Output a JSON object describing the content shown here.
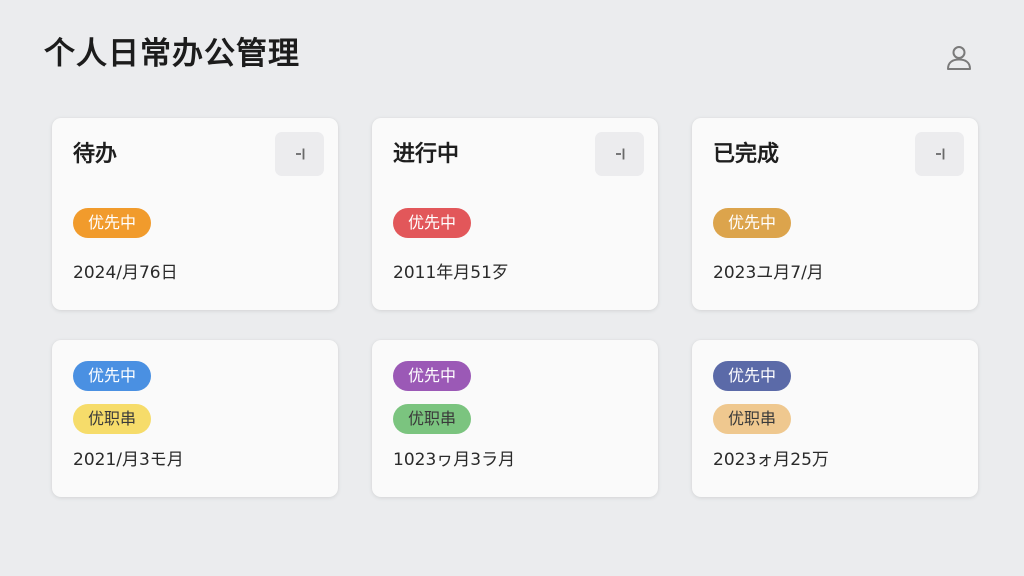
{
  "header": {
    "title": "个人日常办公管理",
    "user_icon": "user-icon"
  },
  "colors": {
    "orange": "#f19b2c",
    "red": "#e2575a",
    "amber": "#dca44c",
    "blue": "#4a90e2",
    "purple": "#9b59b6",
    "indigo": "#5b6aa8",
    "yellow": "#f6dc6a",
    "green": "#7bc47f",
    "peach": "#efc88f"
  },
  "columns": [
    {
      "title": "待办",
      "add_icon": "add-icon",
      "badge": "优先中",
      "date": "2024/月76日"
    },
    {
      "title": "进行中",
      "add_icon": "add-icon",
      "badge": "优先中",
      "date": "2011年月51歹"
    },
    {
      "title": "已完成",
      "add_icon": "add-icon",
      "badge": "优先中",
      "date": "2023ユ月7/月"
    }
  ],
  "tasks": [
    {
      "badge1": "优先中",
      "badge2": "优职串",
      "date": "2021/月3モ月"
    },
    {
      "badge1": "优先中",
      "badge2": "优职串",
      "date": "1023ヮ月3ラ月"
    },
    {
      "badge1": "优先中",
      "badge2": "优职串",
      "date": "2023ォ月25万"
    }
  ]
}
